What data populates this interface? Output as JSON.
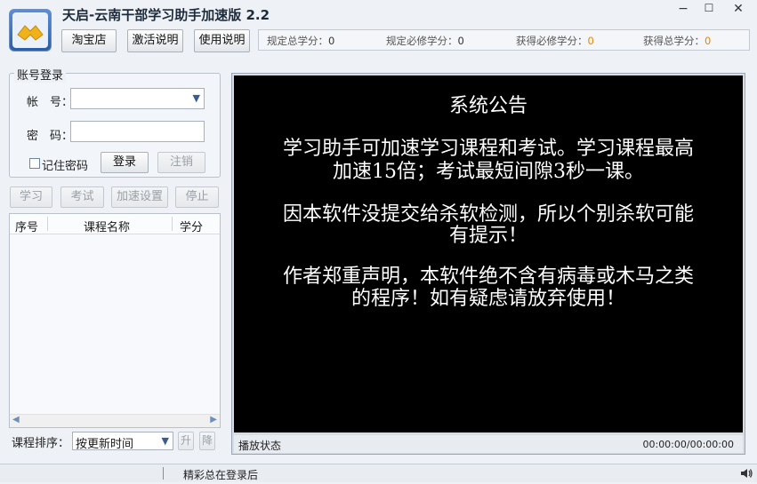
{
  "window": {
    "title": "天启-云南干部学习助手加速版 2.2",
    "controls": {
      "minimize": "−",
      "maximize": "☐",
      "close": "✕"
    }
  },
  "toolbar": {
    "taobao_label": "淘宝店",
    "activate_label": "激活说明",
    "help_label": "使用说明"
  },
  "stats": {
    "required_total_label": "规定总学分：",
    "required_total_value": "0",
    "required_mandatory_label": "规定必修学分：",
    "required_mandatory_value": "0",
    "earned_mandatory_label": "获得必修学分：",
    "earned_mandatory_value": "0",
    "earned_total_label": "获得总学分：",
    "earned_total_value": "0",
    "accent_color": "#e38a00"
  },
  "login": {
    "group_title": "账号登录",
    "account_label": "帐　号：",
    "account_value": "",
    "password_label": "密　码：",
    "password_value": "",
    "remember_label": "记住密码",
    "remember_checked": false,
    "login_label": "登录",
    "logout_label": "注销"
  },
  "actions": {
    "study_label": "学习",
    "exam_label": "考试",
    "speed_label": "加速设置",
    "stop_label": "停止"
  },
  "course_table": {
    "columns": [
      "序号",
      "课程名称",
      "学分"
    ],
    "rows": []
  },
  "sort": {
    "label": "课程排序：",
    "selected": "按更新时间",
    "asc_label": "升",
    "desc_label": "降"
  },
  "player": {
    "notice_title": "系统公告",
    "notice_lines": [
      "学习助手可加速学习课程和考试。学习课程最高",
      "加速15倍；考试最短间隙3秒一课。",
      "",
      "因本软件没提交给杀软检测，所以个别杀软可能",
      "有提示！",
      "",
      "作者郑重声明，本软件绝不含有病毒或木马之类",
      "的程序！如有疑虑请放弃使用！"
    ],
    "status_label": "播放状态",
    "time": "00:00:00/00:00:00"
  },
  "statusbar": {
    "message": "精彩总在登录后",
    "volume_icon": "speaker-icon"
  }
}
